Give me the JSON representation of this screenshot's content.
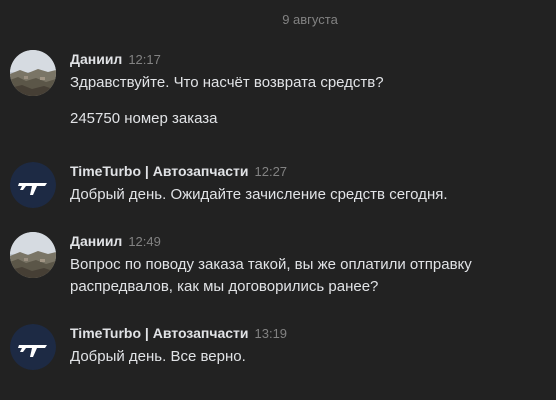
{
  "date_divider": "9 августа",
  "colors": {
    "background": "#222222",
    "text": "#e1e3e6",
    "muted": "#828282",
    "brand_avatar": "#1d2a44"
  },
  "messages": [
    {
      "author": "Даниил",
      "time": "12:17",
      "avatar": "landscape-photo",
      "lines": [
        "Здравствуйте. Что насчёт возврата средств?",
        "245750 номер заказа"
      ]
    },
    {
      "author": "TimeTurbo | Автозапчасти",
      "time": "12:27",
      "avatar": "timeturbo-logo",
      "lines": [
        "Добрый день. Ожидайте зачисление средств сегодня."
      ]
    },
    {
      "author": "Даниил",
      "time": "12:49",
      "avatar": "landscape-photo",
      "lines": [
        "Вопрос по поводу заказа такой, вы же оплатили отправку распредвалов, как мы договорились ранее?"
      ]
    },
    {
      "author": "TimeTurbo | Автозапчасти",
      "time": "13:19",
      "avatar": "timeturbo-logo",
      "lines": [
        "Добрый день. Все верно."
      ]
    }
  ]
}
